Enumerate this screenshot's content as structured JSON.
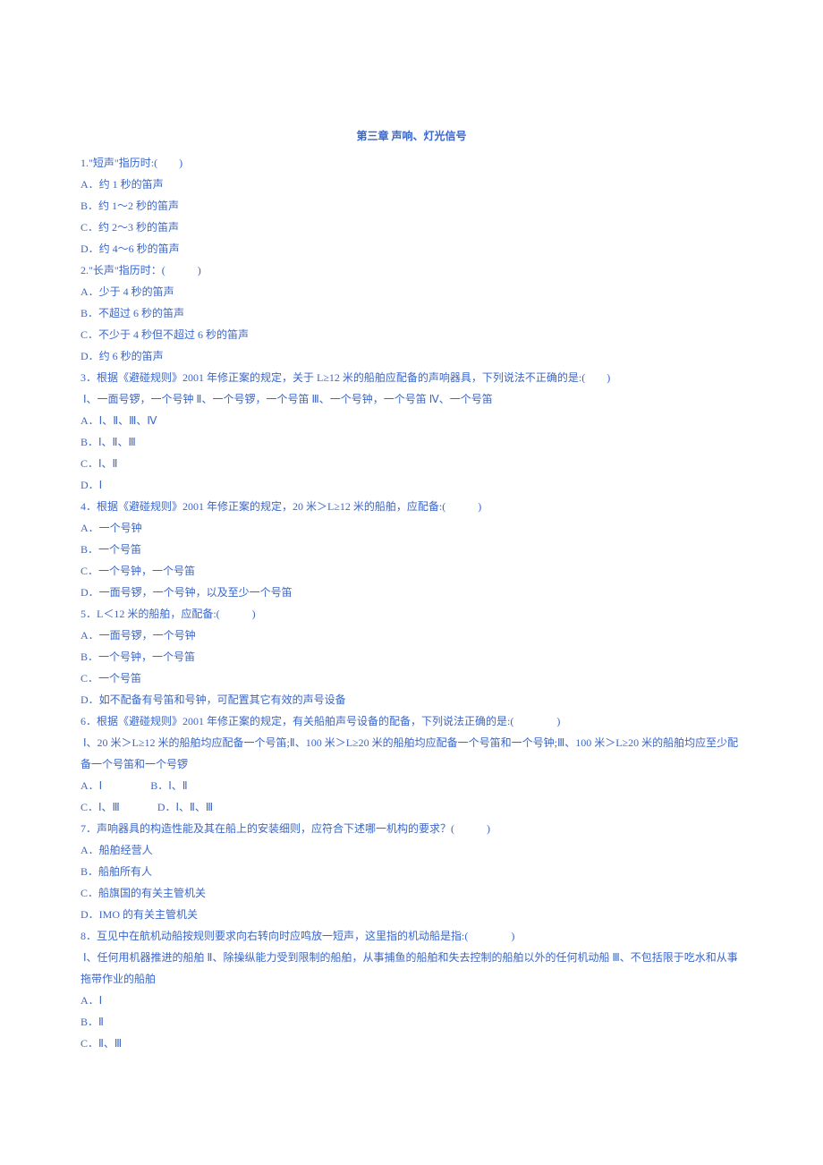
{
  "title": "第三章 声响、灯光信号",
  "questions": [
    {
      "stem": "1.\"短声\"指历时:(　　)",
      "opts": [
        "A．约 1 秒的笛声",
        "B．约 1～2 秒的笛声",
        "C．约 2～3 秒的笛声",
        "D．约 4～6 秒的笛声"
      ]
    },
    {
      "stem": "2.\"长声\"指历时：(　　　)",
      "opts": [
        "A．少于 4 秒的笛声",
        "B．不超过 6 秒的笛声",
        "C．不少于 4 秒但不超过 6 秒的笛声",
        "D．约 6 秒的笛声"
      ]
    },
    {
      "stem": "3．根据《避碰规则》2001 年修正案的规定，关于 L≥12 米的船舶应配备的声响器具，下列说法不正确的是:(　　)",
      "sub": " Ⅰ、一面号锣，一个号钟 Ⅱ、一个号锣，一个号笛 Ⅲ、一个号钟，一个号笛 Ⅳ、一个号笛",
      "opts": [
        "A．Ⅰ、Ⅱ、Ⅲ、Ⅳ",
        "B．Ⅰ、Ⅱ、Ⅲ",
        "C．Ⅰ、Ⅱ",
        "D．Ⅰ"
      ]
    },
    {
      "stem": "4．根据《避碰规则》2001 年修正案的规定，20 米＞L≥12 米的船舶，应配备:(　　　)",
      "opts": [
        "A．一个号钟",
        "B．一个号笛",
        "C．一个号钟，一个号笛",
        "D．一面号锣，一个号钟，以及至少一个号笛"
      ]
    },
    {
      "stem": "5．L＜12 米的船舶，应配备:(　　　)",
      "opts": [
        "A．一面号锣，一个号钟",
        "B．一个号钟，一个号笛",
        "C．一个号笛",
        "D．如不配备有号笛和号钟，可配置其它有效的声号设备"
      ]
    },
    {
      "stem": "6．根据《避碰规则》2001 年修正案的规定，有关船舶声号设备的配备，下列说法正确的是:(　　　　)",
      "sub": " Ⅰ、20 米＞L≥12 米的船舶均应配备一个号笛;Ⅱ、100 米＞L≥20 米的船舶均应配备一个号笛和一个号钟;Ⅲ、100 米＞L≥20 米的船舶均应至少配备一个号笛和一个号锣",
      "opts_inline": [
        [
          "A．Ⅰ",
          "B．Ⅰ、Ⅱ"
        ],
        [
          "C．Ⅰ、Ⅲ",
          "D．Ⅰ、Ⅱ、Ⅲ"
        ]
      ]
    },
    {
      "stem": "7．声响器具的构造性能及其在船上的安装细则，应符合下述哪一机构的要求？(　　　)",
      "opts": [
        "A．船舶经营人",
        "B．船舶所有人",
        "C．船旗国的有关主管机关",
        "D．IMO 的有关主管机关"
      ]
    },
    {
      "stem": "8．互见中在航机动船按规则要求向右转向时应鸣放一短声，这里指的机动船是指:(　　　　)",
      "sub": " Ⅰ、任何用机器推进的船舶 Ⅱ、除操纵能力受到限制的船舶，从事捕鱼的船舶和失去控制的船舶以外的任何机动船 Ⅲ、不包括限于吃水和从事拖带作业的船舶",
      "opts": [
        "A．Ⅰ",
        "B．Ⅱ",
        "C．Ⅱ、Ⅲ"
      ]
    }
  ]
}
